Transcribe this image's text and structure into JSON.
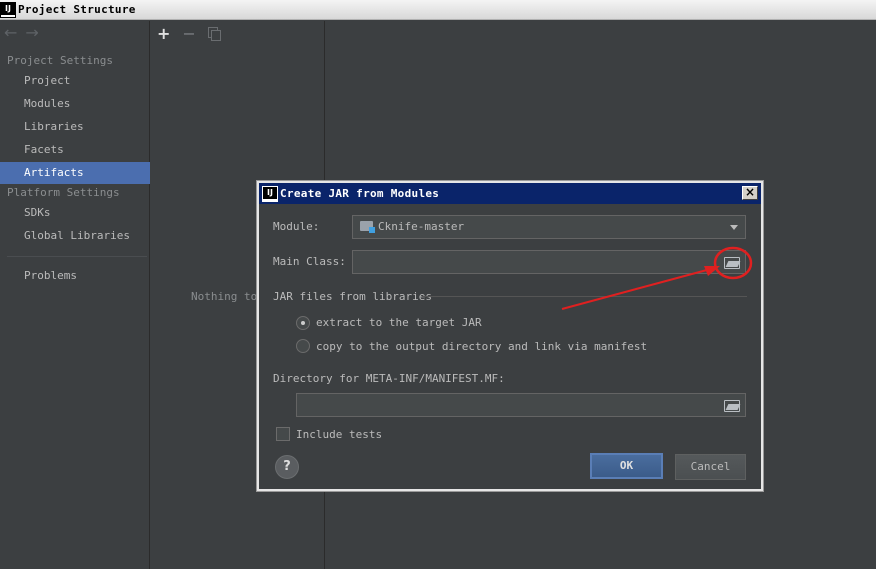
{
  "window": {
    "logo_text": "IJ",
    "title": "Project Structure"
  },
  "sidebar": {
    "back_glyph": "←",
    "forward_glyph": "→",
    "project_settings_header": "Project Settings",
    "project_items": [
      {
        "label": "Project"
      },
      {
        "label": "Modules"
      },
      {
        "label": "Libraries"
      },
      {
        "label": "Facets"
      },
      {
        "label": "Artifacts",
        "selected": true
      }
    ],
    "platform_settings_header": "Platform Settings",
    "platform_items": [
      {
        "label": "SDKs"
      },
      {
        "label": "Global Libraries"
      }
    ],
    "problems_label": "Problems"
  },
  "middle_panel": {
    "add_glyph": "+",
    "remove_glyph": "−",
    "empty_text": "Nothing to"
  },
  "dialog": {
    "logo_text": "IJ",
    "title": "Create JAR from Modules",
    "close_glyph": "×",
    "module_label": "Module:",
    "module_value": "Cknife-master",
    "main_class_label": "Main Class:",
    "main_class_value": "",
    "jar_files_group_label": "JAR files from libraries",
    "option_extract": "extract to the target JAR",
    "option_copy": "copy to the output directory and link via manifest",
    "selected_option": "extract",
    "manifest_dir_label": "Directory for META-INF/MANIFEST.MF:",
    "manifest_dir_value": "",
    "include_tests_label": "Include tests",
    "include_tests_checked": false,
    "help_glyph": "?",
    "ok_label": "OK",
    "cancel_label": "Cancel"
  },
  "colors": {
    "background": "#3c3f41",
    "selection": "#4b6eaf",
    "dialog_titlebar": "#0a246a",
    "annotation_red": "#e02020"
  },
  "icons": {
    "folder": "folder-icon",
    "browse": "folder-open-icon",
    "dropdown": "chevron-down-icon"
  }
}
